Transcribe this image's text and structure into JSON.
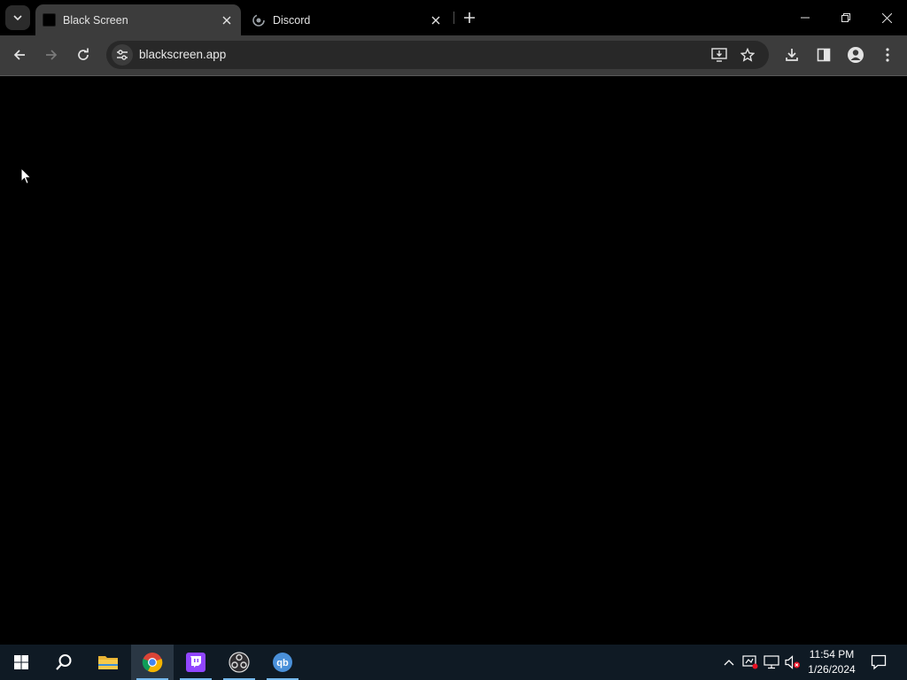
{
  "browser": {
    "tabs": [
      {
        "title": "Black Screen",
        "active": true
      },
      {
        "title": "Discord",
        "active": false
      }
    ],
    "address": "blackscreen.app"
  },
  "taskbar": {
    "time": "11:54 PM",
    "date": "1/26/2024",
    "apps": [
      "start-icon",
      "search-icon",
      "file-explorer-icon",
      "chrome-icon",
      "twitch-icon",
      "obs-icon",
      "qbittorrent-icon"
    ]
  },
  "colors": {
    "tab_active": "#3c3c3c",
    "toolbar": "#3c3c3c",
    "omnibox": "#282828",
    "page": "#000000",
    "taskbar": "#0f1a24",
    "accent": "#76b9ed"
  }
}
